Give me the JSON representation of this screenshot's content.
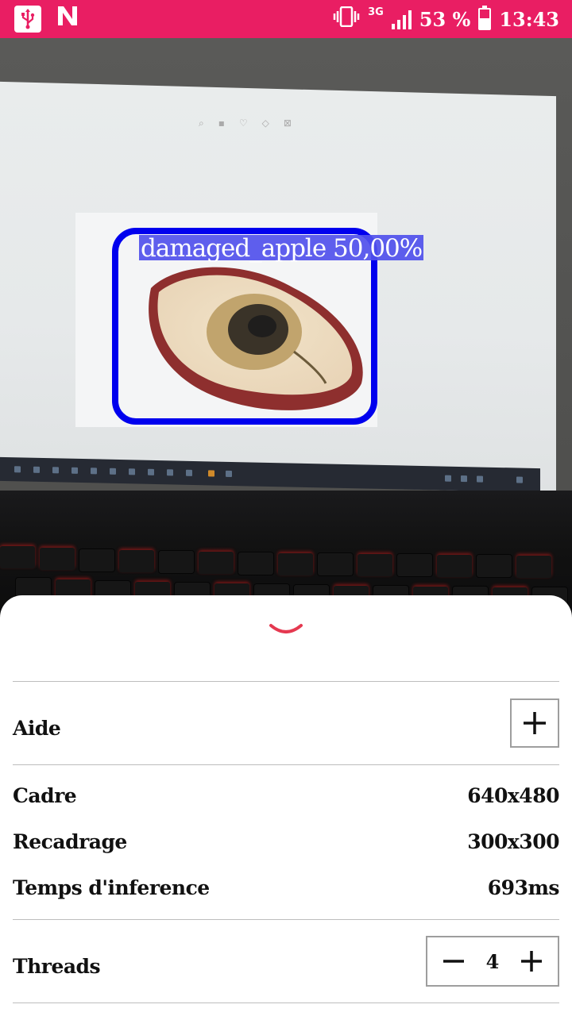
{
  "status_bar": {
    "network": "3G",
    "battery": "53 %",
    "battery_level": 0.53,
    "time": "13:43",
    "background_color": "#e91e63",
    "icons": [
      "usb-icon",
      "n-notification-icon",
      "vibrate-icon",
      "signal-icon",
      "battery-icon"
    ]
  },
  "detection": {
    "label": "damaged_apple 50,00%",
    "box_color": "#0000ee"
  },
  "sheet": {
    "collapse_icon": "chevron-down-icon",
    "accent_color": "#e53950",
    "help": {
      "label": "Aide",
      "icon": "plus-icon"
    },
    "frame": {
      "label": "Cadre",
      "value": "640x480"
    },
    "crop": {
      "label": "Recadrage",
      "value": "300x300"
    },
    "inference": {
      "label": "Temps d'inference",
      "value": "693ms"
    },
    "threads": {
      "label": "Threads",
      "value": "4",
      "minus_icon": "minus-icon",
      "plus_icon": "plus-icon"
    }
  }
}
